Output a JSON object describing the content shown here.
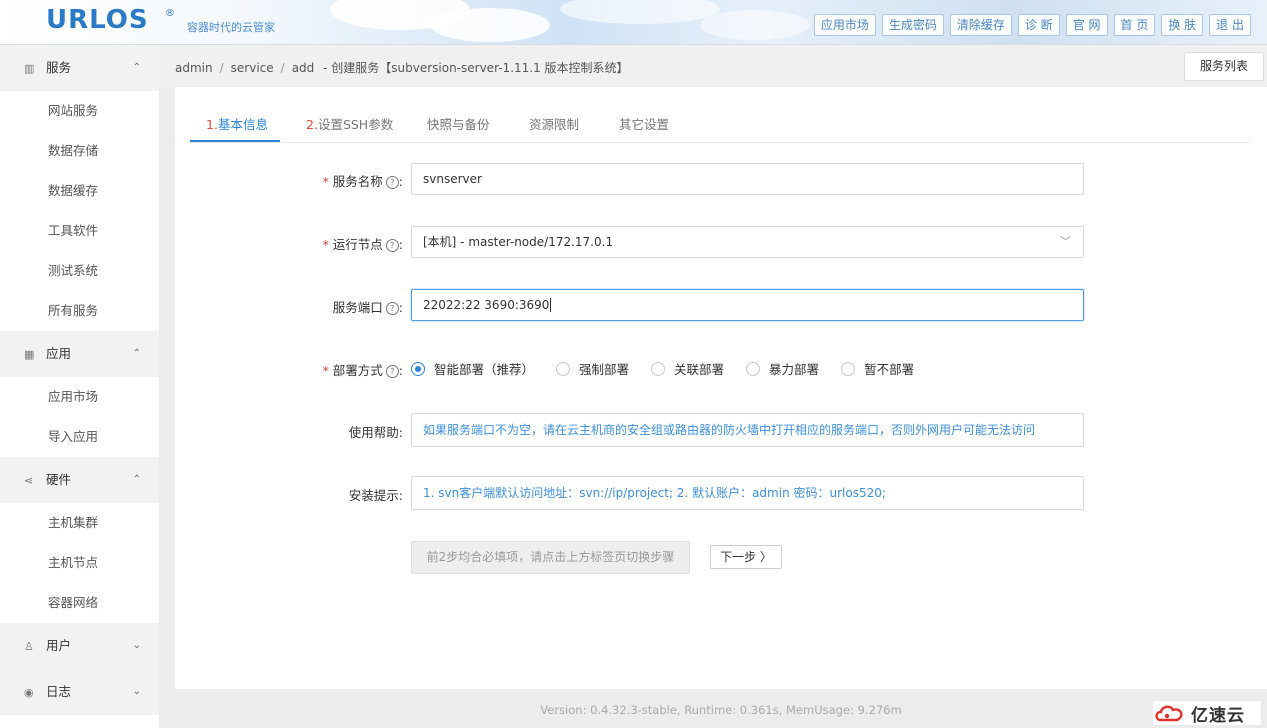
{
  "header": {
    "logo": "URLOS",
    "logo_reg": "®",
    "slogan": "容器时代的云管家",
    "nav": [
      "应用市场",
      "生成密码",
      "清除缓存",
      "诊 断",
      "官 网",
      "首 页",
      "换 肤",
      "退 出"
    ]
  },
  "sidebar": {
    "groups": [
      {
        "label": "服务",
        "icon": "server-icon",
        "chevron": "⌃",
        "items": [
          "网站服务",
          "数据存储",
          "数据缓存",
          "工具软件",
          "测试系统",
          "所有服务"
        ]
      },
      {
        "label": "应用",
        "icon": "grid-icon",
        "chevron": "⌃",
        "items": [
          "应用市场",
          "导入应用"
        ]
      },
      {
        "label": "硬件",
        "icon": "share-icon",
        "chevron": "⌃",
        "items": [
          "主机集群",
          "主机节点",
          "容器网络"
        ]
      },
      {
        "label": "用户",
        "icon": "user-icon",
        "chevron": "⌄",
        "items": []
      },
      {
        "label": "日志",
        "icon": "eye-icon",
        "chevron": "⌄",
        "items": []
      }
    ]
  },
  "breadcrumb": {
    "c1": "admin",
    "c2": "service",
    "c3": "add",
    "title": "- 创建服务【subversion-server-1.11.1 版本控制系统】"
  },
  "list_button": "服务列表",
  "tabs": [
    {
      "num": "1.",
      "label": "基本信息"
    },
    {
      "num": "2.",
      "label": "设置SSH参数"
    },
    {
      "num": "",
      "label": "快照与备份"
    },
    {
      "num": "",
      "label": "资源限制"
    },
    {
      "num": "",
      "label": "其它设置"
    }
  ],
  "form": {
    "name_label": "服务名称",
    "name_value": "svnserver",
    "node_label": "运行节点",
    "node_value": "[本机] - master-node/172.17.0.1",
    "port_label": "服务端口",
    "port_value": "22022:22 3690:3690",
    "deploy_label": "部署方式",
    "deploy_options": [
      "智能部署（推荐）",
      "强制部署",
      "关联部署",
      "暴力部署",
      "暂不部署"
    ],
    "help_label": "使用帮助:",
    "help_text": "如果服务端口不为空，请在云主机商的安全组或路由器的防火墙中打开相应的服务端口，否则外网用户可能无法访问",
    "install_label": "安装提示:",
    "install_text": "1. svn客户端默认访问地址：svn://ip/project;  2. 默认账户：admin 密码：urlos520;",
    "hint_button": "前2步均合必填项，请点击上方标签页切换步骤",
    "next_button": "下一步  〉"
  },
  "footer": "Version: 0.4.32.3-stable,   Runtime: 0.361s,   MemUsage: 9.276m",
  "watermark": "亿速云",
  "colors": {
    "accent": "#2b84d6",
    "required": "#e03a2f",
    "logo": "#2a7ac6"
  }
}
